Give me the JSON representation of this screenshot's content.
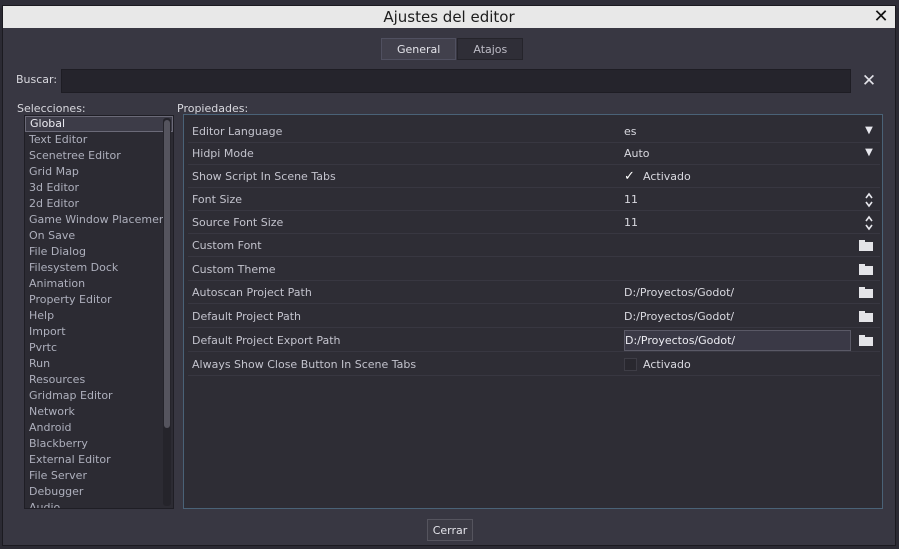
{
  "window": {
    "title": "Ajustes del editor"
  },
  "tabs": [
    {
      "label": "General",
      "active": true
    },
    {
      "label": "Atajos",
      "active": false
    }
  ],
  "search": {
    "label": "Buscar:",
    "value": ""
  },
  "sections": {
    "left": "Selecciones:",
    "right": "Propiedades:"
  },
  "categories": [
    "Global",
    "Text Editor",
    "Scenetree Editor",
    "Grid Map",
    "3d Editor",
    "2d Editor",
    "Game Window Placement",
    "On Save",
    "File Dialog",
    "Filesystem Dock",
    "Animation",
    "Property Editor",
    "Help",
    "Import",
    "Pvrtc",
    "Run",
    "Resources",
    "Gridmap Editor",
    "Network",
    "Android",
    "Blackberry",
    "External Editor",
    "File Server",
    "Debugger",
    "Audio"
  ],
  "selected_category": "Global",
  "properties": [
    {
      "name": "Editor Language",
      "value": "es",
      "control": "dropdown"
    },
    {
      "name": "Hidpi Mode",
      "value": "Auto",
      "control": "dropdown"
    },
    {
      "name": "Show Script In Scene Tabs",
      "value": "Activado",
      "control": "checkbox",
      "checked": true
    },
    {
      "name": "Font Size",
      "value": "11",
      "control": "spinner"
    },
    {
      "name": "Source Font Size",
      "value": "11",
      "control": "spinner"
    },
    {
      "name": "Custom Font",
      "value": "",
      "control": "file"
    },
    {
      "name": "Custom Theme",
      "value": "",
      "control": "file"
    },
    {
      "name": "Autoscan Project Path",
      "value": "D:/Proyectos/Godot/",
      "control": "file"
    },
    {
      "name": "Default Project Path",
      "value": "D:/Proyectos/Godot/",
      "control": "file"
    },
    {
      "name": "Default Project Export Path",
      "value": "D:/Proyectos/Godot/",
      "control": "file-edit"
    },
    {
      "name": "Always Show Close Button In Scene Tabs",
      "value": "Activado",
      "control": "checkbox",
      "checked": false
    }
  ],
  "footer": {
    "close_label": "Cerrar"
  },
  "colors": {
    "accent_border": "#4a6277",
    "panel_bg": "#2e2d35",
    "dialog_bg": "#383742"
  },
  "icons": {
    "close": "x-icon",
    "dropdown": "chevron-down-icon",
    "spinner": "up-down-arrows-icon",
    "file": "folder-icon",
    "check": "checkmark-icon"
  }
}
